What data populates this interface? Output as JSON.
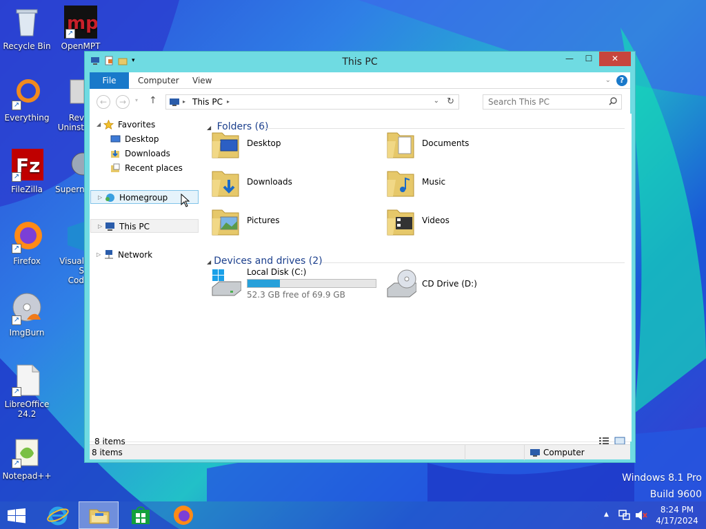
{
  "desktop": {
    "icons": [
      {
        "label": "Recycle Bin"
      },
      {
        "label": "OpenMPT"
      },
      {
        "label": "Everything"
      },
      {
        "label": "Rev"
      },
      {
        "label": "Uninst"
      },
      {
        "label": "FileZilla"
      },
      {
        "label": "Supern"
      },
      {
        "label": "Firefox"
      },
      {
        "label": "Visual S"
      },
      {
        "label": "Cod"
      },
      {
        "label": "ImgBurn"
      },
      {
        "label": "LibreOffice 24.2"
      },
      {
        "label": "Notepad++"
      }
    ],
    "watermark": {
      "line1": "Windows 8.1 Pro",
      "line2": "Build 9600"
    }
  },
  "window": {
    "title": "This PC",
    "controls": {
      "minimize": "—",
      "maximize": "☐",
      "close": "✕"
    },
    "ribbon": {
      "tabs": [
        "File",
        "Computer",
        "View"
      ],
      "help": "?"
    },
    "address": {
      "path": "This PC"
    },
    "search": {
      "placeholder": "Search This PC"
    },
    "nav": {
      "favorites": "Favorites",
      "desktop": "Desktop",
      "downloads": "Downloads",
      "recent": "Recent places",
      "homegroup": "Homegroup",
      "thispc": "This PC",
      "network": "Network"
    },
    "groups": {
      "folders": "Folders (6)",
      "devices": "Devices and drives (2)"
    },
    "folders": [
      "Desktop",
      "Documents",
      "Downloads",
      "Music",
      "Pictures",
      "Videos"
    ],
    "drives": [
      {
        "name": "Local Disk (C:)",
        "detail": "52.3 GB free of 69.9 GB",
        "used_fraction": 0.25
      },
      {
        "name": "CD Drive (D:)"
      }
    ],
    "status": {
      "items": "8 items",
      "bottom_items": "8 items",
      "computer": "Computer"
    }
  },
  "taskbar": {
    "time": "8:24 PM",
    "date": "4/17/2024"
  },
  "colors": {
    "accent": "#1979ca",
    "title_bg": "#6fdbe2",
    "drive_bar": "#26a0da",
    "group_text": "#1a3e8c"
  }
}
